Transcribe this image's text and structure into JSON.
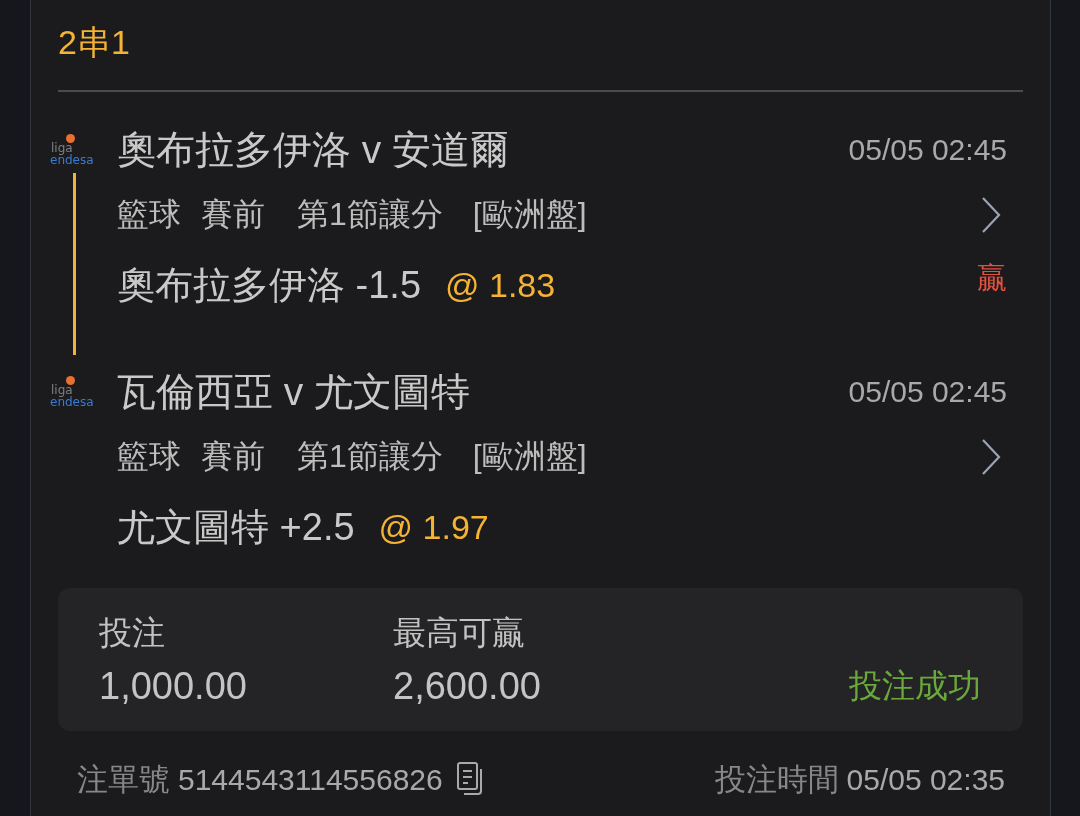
{
  "bet_type": "2串1",
  "legs": [
    {
      "league_logo": {
        "top": "liga",
        "bottom": "endesa"
      },
      "match": "奧布拉多伊洛 v 安道爾",
      "kickoff": "05/05 02:45",
      "sport": "籃球",
      "stage": "賽前",
      "market": "第1節讓分",
      "odds_format": "[歐洲盤]",
      "selection": "奧布拉多伊洛 -1.5",
      "odds": "@ 1.83",
      "result": {
        "kind": "win",
        "text": "贏"
      }
    },
    {
      "league_logo": {
        "top": "liga",
        "bottom": "endesa"
      },
      "match": "瓦倫西亞 v 尤文圖特",
      "kickoff": "05/05 02:45",
      "sport": "籃球",
      "stage": "賽前",
      "market": "第1節讓分",
      "odds_format": "[歐洲盤]",
      "selection": "尤文圖特 +2.5",
      "odds": "@ 1.97"
    }
  ],
  "summary": {
    "stake": {
      "label": "投注",
      "value": "1,000.00"
    },
    "max_payout": {
      "label": "最高可贏",
      "value": "2,600.00"
    },
    "status": {
      "kind": "success",
      "text": "投注成功"
    }
  },
  "footer": {
    "bet_id": {
      "label": "注單號",
      "value": "5144543114556826"
    },
    "placed_at": {
      "label": "投注時間",
      "value": "05/05 02:35"
    }
  }
}
